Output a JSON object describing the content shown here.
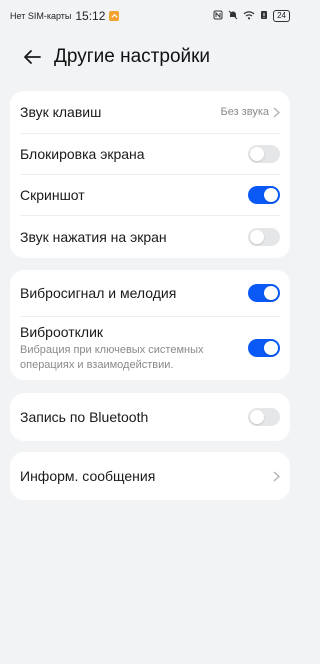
{
  "status_bar": {
    "carrier": "Нет SIM-карты",
    "time": "15:12",
    "battery": "24"
  },
  "header": {
    "title": "Другие настройки"
  },
  "groups": {
    "sound": {
      "key_sound_label": "Звук клавиш",
      "key_sound_value": "Без звука",
      "screen_lock_label": "Блокировка экрана",
      "screen_lock_on": false,
      "screenshot_label": "Скриншот",
      "screenshot_on": true,
      "touch_sound_label": "Звук нажатия на экран",
      "touch_sound_on": false
    },
    "vibration": {
      "vibro_melody_label": "Вибросигнал и мелодия",
      "vibro_melody_on": true,
      "haptic_label": "Виброотклик",
      "haptic_desc": "Вибрация при ключевых системных операциях и взаимодействии.",
      "haptic_on": true
    },
    "bluetooth": {
      "record_label": "Запись по Bluetooth",
      "record_on": false
    },
    "messages": {
      "label": "Информ. сообщения"
    }
  },
  "colors": {
    "accent": "#0a59f7",
    "toggle_off": "#e5e6e8",
    "background": "#f1f3f5"
  }
}
